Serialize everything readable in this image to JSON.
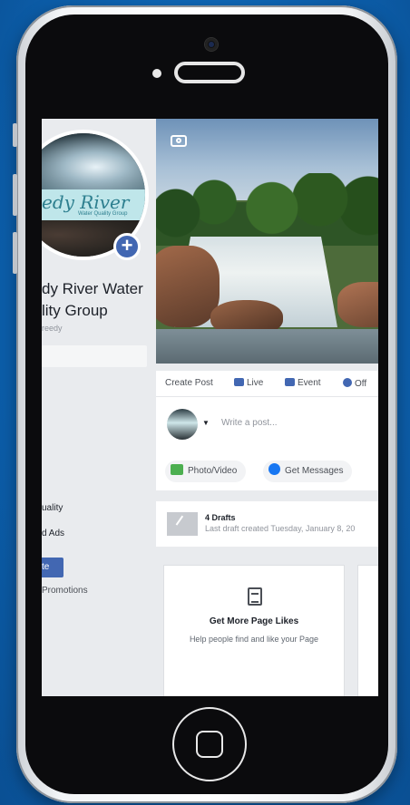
{
  "sidebar": {
    "page_name_line1": "dy River Water",
    "page_name_line2": "lity Group",
    "page_handle": "reedy",
    "avatar_logo_text": "edy River",
    "avatar_logo_sub": "Water Quality Group",
    "nav_items": [
      "",
      "",
      "",
      "uality",
      "d Ads"
    ],
    "promote_label": "te",
    "promotions_label": "Promotions"
  },
  "composer": {
    "tabs": [
      {
        "label": "Create Post",
        "icon": "",
        "color": ""
      },
      {
        "label": "Live",
        "icon": "live-video-icon",
        "color": "#4267b2"
      },
      {
        "label": "Event",
        "icon": "calendar-icon",
        "color": "#4267b2"
      },
      {
        "label": "Off",
        "icon": "offer-icon",
        "color": "#4267b2"
      }
    ],
    "placeholder": "Write a post...",
    "chips": [
      {
        "label": "Photo/Video",
        "icon": "photo-icon",
        "color": "#4caf50"
      },
      {
        "label": "Get Messages",
        "icon": "messenger-icon",
        "color": "#1877f2"
      }
    ]
  },
  "drafts": {
    "title": "4 Drafts",
    "subtitle": "Last draft created Tuesday, January 8, 20"
  },
  "card": {
    "title": "Get More Page Likes",
    "subtitle": "Help people find and like your Page"
  }
}
